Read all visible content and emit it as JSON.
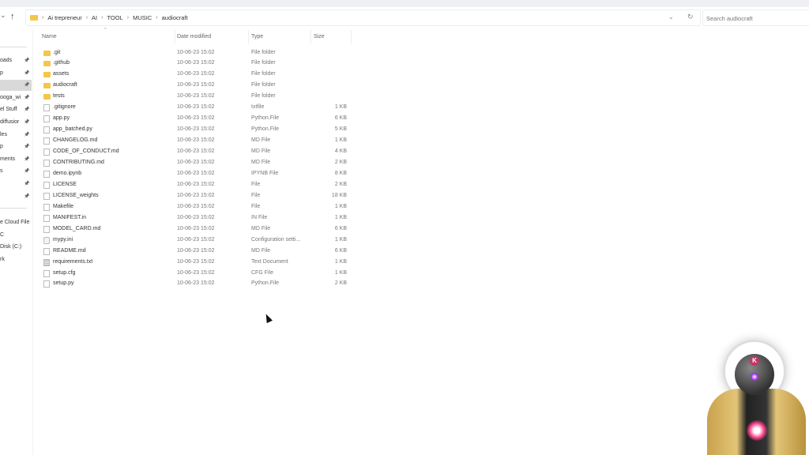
{
  "nav": {
    "back_icon": "chevron-down",
    "up_icon": "arrow-up",
    "breadcrumb": [
      "Ai trepreneur",
      "AI",
      "TOOL",
      "MUSIC",
      "audiocraft"
    ],
    "search_placeholder": "Search audiocraft"
  },
  "sidebar": {
    "items": [
      {
        "label": "oads",
        "pinned": true
      },
      {
        "label": "p",
        "pinned": true
      },
      {
        "label": "",
        "pinned": true,
        "selected": true
      },
      {
        "label": "ooga_wi",
        "pinned": true
      },
      {
        "label": "el Stuff",
        "pinned": true
      },
      {
        "label": "diffusior",
        "pinned": true
      },
      {
        "label": "les",
        "pinned": true
      },
      {
        "label": "p",
        "pinned": true
      },
      {
        "label": "ments",
        "pinned": true
      },
      {
        "label": "s",
        "pinned": true
      },
      {
        "label": "",
        "pinned": true
      },
      {
        "label": "",
        "pinned": true
      }
    ],
    "lower": [
      "e Cloud File",
      "C",
      "Disk (C:)",
      "rk"
    ]
  },
  "columns": {
    "name": "Name",
    "date": "Date modified",
    "type": "Type",
    "size": "Size"
  },
  "files": [
    {
      "name": ".git",
      "date": "10-06-23 15:02",
      "type": "File folder",
      "size": "",
      "icon": "folder"
    },
    {
      "name": ".github",
      "date": "10-06-23 15:02",
      "type": "File folder",
      "size": "",
      "icon": "folder"
    },
    {
      "name": "assets",
      "date": "10-06-23 15:02",
      "type": "File folder",
      "size": "",
      "icon": "folder"
    },
    {
      "name": "audiocraft",
      "date": "10-06-23 15:02",
      "type": "File folder",
      "size": "",
      "icon": "folder"
    },
    {
      "name": "tests",
      "date": "10-06-23 15:02",
      "type": "File folder",
      "size": "",
      "icon": "folder"
    },
    {
      "name": ".gitignore",
      "date": "10-06-23 15:02",
      "type": "txtfile",
      "size": "1 KB",
      "icon": "file"
    },
    {
      "name": "app.py",
      "date": "10-06-23 15:02",
      "type": "Python.File",
      "size": "6 KB",
      "icon": "file"
    },
    {
      "name": "app_batched.py",
      "date": "10-06-23 15:02",
      "type": "Python.File",
      "size": "5 KB",
      "icon": "file"
    },
    {
      "name": "CHANGELOG.md",
      "date": "10-06-23 15:02",
      "type": "MD File",
      "size": "1 KB",
      "icon": "file"
    },
    {
      "name": "CODE_OF_CONDUCT.md",
      "date": "10-06-23 15:02",
      "type": "MD File",
      "size": "4 KB",
      "icon": "file"
    },
    {
      "name": "CONTRIBUTING.md",
      "date": "10-06-23 15:02",
      "type": "MD File",
      "size": "2 KB",
      "icon": "file"
    },
    {
      "name": "demo.ipynb",
      "date": "10-06-23 15:02",
      "type": "IPYNB File",
      "size": "8 KB",
      "icon": "file"
    },
    {
      "name": "LICENSE",
      "date": "10-06-23 15:02",
      "type": "File",
      "size": "2 KB",
      "icon": "file"
    },
    {
      "name": "LICENSE_weights",
      "date": "10-06-23 15:02",
      "type": "File",
      "size": "18 KB",
      "icon": "file"
    },
    {
      "name": "Makefile",
      "date": "10-06-23 15:02",
      "type": "File",
      "size": "1 KB",
      "icon": "file"
    },
    {
      "name": "MANIFEST.in",
      "date": "10-06-23 15:02",
      "type": "IN File",
      "size": "1 KB",
      "icon": "file"
    },
    {
      "name": "MODEL_CARD.md",
      "date": "10-06-23 15:02",
      "type": "MD File",
      "size": "6 KB",
      "icon": "file"
    },
    {
      "name": "mypy.ini",
      "date": "10-06-23 15:02",
      "type": "Configuration setti...",
      "size": "1 KB",
      "icon": "ini"
    },
    {
      "name": "README.md",
      "date": "10-06-23 15:02",
      "type": "MD File",
      "size": "6 KB",
      "icon": "file"
    },
    {
      "name": "requirements.txt",
      "date": "10-06-23 15:02",
      "type": "Text Document",
      "size": "1 KB",
      "icon": "txt"
    },
    {
      "name": "setup.cfg",
      "date": "10-06-23 15:02",
      "type": "CFG File",
      "size": "1 KB",
      "icon": "file"
    },
    {
      "name": "setup.py",
      "date": "10-06-23 15:02",
      "type": "Python.File",
      "size": "2 KB",
      "icon": "file"
    }
  ],
  "avatar": {
    "badge": "K"
  }
}
